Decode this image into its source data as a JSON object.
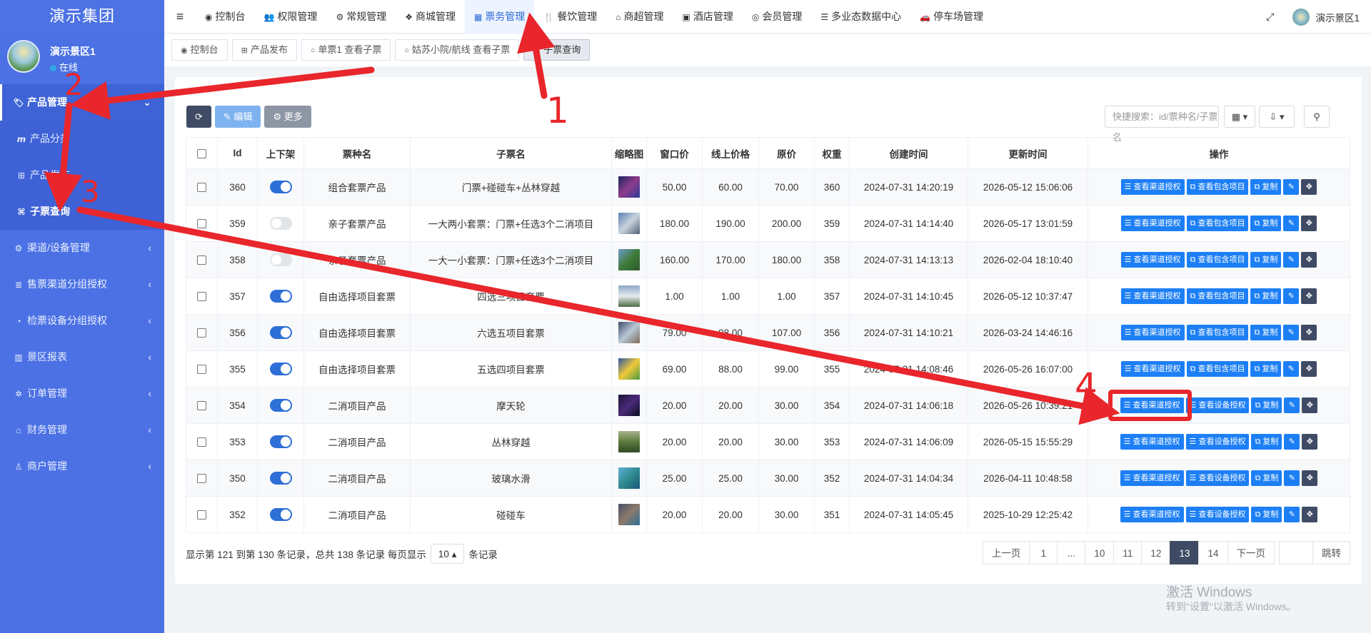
{
  "sidebar": {
    "brand": "演示集团",
    "user_name": "演示景区1",
    "user_status": "在线",
    "menu": [
      {
        "label": "产品管理",
        "icon": "tag-icon"
      },
      {
        "label": "渠道/设备管理",
        "icon": "cogs-icon"
      },
      {
        "label": "售票渠道分组授权",
        "icon": "database-icon"
      },
      {
        "label": "检票设备分组授权",
        "icon": "gauge-icon"
      },
      {
        "label": "景区报表",
        "icon": "bar-chart-icon"
      },
      {
        "label": "订单管理",
        "icon": "gear-icon"
      },
      {
        "label": "财务管理",
        "icon": "bank-icon"
      },
      {
        "label": "商户管理",
        "icon": "person-icon"
      }
    ],
    "submenu": [
      {
        "label": "产品分类"
      },
      {
        "label": "产品发布"
      },
      {
        "label": "子票查询"
      }
    ]
  },
  "topnav": [
    {
      "label": "控制台",
      "icon": "dashboard-icon"
    },
    {
      "label": "权限管理",
      "icon": "users-icon"
    },
    {
      "label": "常规管理",
      "icon": "cogs-icon"
    },
    {
      "label": "商城管理",
      "icon": "dropbox-icon"
    },
    {
      "label": "票务管理",
      "icon": "grid-icon"
    },
    {
      "label": "餐饮管理",
      "icon": "cutlery-icon"
    },
    {
      "label": "商超管理",
      "icon": "bank-icon"
    },
    {
      "label": "酒店管理",
      "icon": "building-icon"
    },
    {
      "label": "会员管理",
      "icon": "user-circle-icon"
    },
    {
      "label": "多业态数据中心",
      "icon": "bars-icon"
    },
    {
      "label": "停车场管理",
      "icon": "car-icon"
    }
  ],
  "topright": {
    "user": "演示景区1"
  },
  "tabs": [
    {
      "label": "控制台"
    },
    {
      "label": "产品发布"
    },
    {
      "label": "单票1 查看子票"
    },
    {
      "label": "姑苏小院/航线 查看子票"
    },
    {
      "label": "子票查询"
    }
  ],
  "toolbar": {
    "edit": "编辑",
    "more": "更多",
    "search_placeholder": "快捷搜索：id/票种名/子票名"
  },
  "table": {
    "headers": [
      "Id",
      "上下架",
      "票种名",
      "子票名",
      "缩略图",
      "窗口价",
      "线上价格",
      "原价",
      "权重",
      "创建时间",
      "更新时间",
      "操作"
    ],
    "rows": [
      {
        "id": "360",
        "on": true,
        "type": "组合套票产品",
        "name": "门票+碰碰车+丛林穿越",
        "window": "50.00",
        "online": "60.00",
        "orig": "70.00",
        "weight": "360",
        "created": "2024-07-31 14:20:19",
        "updated": "2026-05-12 15:06:06",
        "op1": "查看渠道授权",
        "op2": "查看包含项目",
        "op3": "复制"
      },
      {
        "id": "359",
        "on": false,
        "type": "亲子套票产品",
        "name": "一大两小套票：门票+任选3个二消项目",
        "window": "180.00",
        "online": "190.00",
        "orig": "200.00",
        "weight": "359",
        "created": "2024-07-31 14:14:40",
        "updated": "2026-05-17 13:01:59",
        "op1": "查看渠道授权",
        "op2": "查看包含项目",
        "op3": "复制"
      },
      {
        "id": "358",
        "on": false,
        "type": "亲子套票产品",
        "name": "一大一小套票：门票+任选3个二消项目",
        "window": "160.00",
        "online": "170.00",
        "orig": "180.00",
        "weight": "358",
        "created": "2024-07-31 14:13:13",
        "updated": "2026-02-04 18:10:40",
        "op1": "查看渠道授权",
        "op2": "查看包含项目",
        "op3": "复制"
      },
      {
        "id": "357",
        "on": true,
        "type": "自由选择项目套票",
        "name": "四选三项目套票",
        "window": "1.00",
        "online": "1.00",
        "orig": "1.00",
        "weight": "357",
        "created": "2024-07-31 14:10:45",
        "updated": "2026-05-12 10:37:47",
        "op1": "查看渠道授权",
        "op2": "查看包含项目",
        "op3": "复制"
      },
      {
        "id": "356",
        "on": true,
        "type": "自由选择项目套票",
        "name": "六选五项目套票",
        "window": "79.00",
        "online": "98.00",
        "orig": "107.00",
        "weight": "356",
        "created": "2024-07-31 14:10:21",
        "updated": "2026-03-24 14:46:16",
        "op1": "查看渠道授权",
        "op2": "查看包含项目",
        "op3": "复制"
      },
      {
        "id": "355",
        "on": true,
        "type": "自由选择项目套票",
        "name": "五选四项目套票",
        "window": "69.00",
        "online": "88.00",
        "orig": "99.00",
        "weight": "355",
        "created": "2024-07-31 14:08:46",
        "updated": "2026-05-26 16:07:00",
        "op1": "查看渠道授权",
        "op2": "查看包含项目",
        "op3": "复制"
      },
      {
        "id": "354",
        "on": true,
        "type": "二消项目产品",
        "name": "摩天轮",
        "window": "20.00",
        "online": "20.00",
        "orig": "30.00",
        "weight": "354",
        "created": "2024-07-31 14:06:18",
        "updated": "2026-05-26 10:39:21",
        "op1": "查看渠道授权",
        "op2": "查看设备授权",
        "op3": "复制"
      },
      {
        "id": "353",
        "on": true,
        "type": "二消项目产品",
        "name": "丛林穿越",
        "window": "20.00",
        "online": "20.00",
        "orig": "30.00",
        "weight": "353",
        "created": "2024-07-31 14:06:09",
        "updated": "2026-05-15 15:55:29",
        "op1": "查看渠道授权",
        "op2": "查看设备授权",
        "op3": "复制"
      },
      {
        "id": "350",
        "on": true,
        "type": "二消项目产品",
        "name": "玻璃水滑",
        "window": "25.00",
        "online": "25.00",
        "orig": "30.00",
        "weight": "352",
        "created": "2024-07-31 14:04:34",
        "updated": "2026-04-11 10:48:58",
        "op1": "查看渠道授权",
        "op2": "查看设备授权",
        "op3": "复制"
      },
      {
        "id": "352",
        "on": true,
        "type": "二消项目产品",
        "name": "碰碰车",
        "window": "20.00",
        "online": "20.00",
        "orig": "30.00",
        "weight": "351",
        "created": "2024-07-31 14:05:45",
        "updated": "2025-10-29 12:25:42",
        "op1": "查看渠道授权",
        "op2": "查看设备授权",
        "op3": "复制"
      }
    ]
  },
  "footer": {
    "info_pre": "显示第 121 到第 130 条记录，总共 138 条记录 每页显示",
    "page_size": "10",
    "info_post": "条记录"
  },
  "pager": {
    "prev": "上一页",
    "pages": [
      "1",
      "...",
      "10",
      "11",
      "12",
      "13",
      "14"
    ],
    "current": "13",
    "next": "下一页",
    "jump": "跳转"
  },
  "watermark": {
    "line1": "激活 Windows",
    "line2": "转到\"设置\"以激活 Windows。"
  },
  "annotations": [
    "1",
    "2",
    "3",
    "4"
  ],
  "colors": {
    "sidebar": "#4b71e4",
    "accent": "#1d7ff5",
    "annotation": "#e8262b"
  }
}
